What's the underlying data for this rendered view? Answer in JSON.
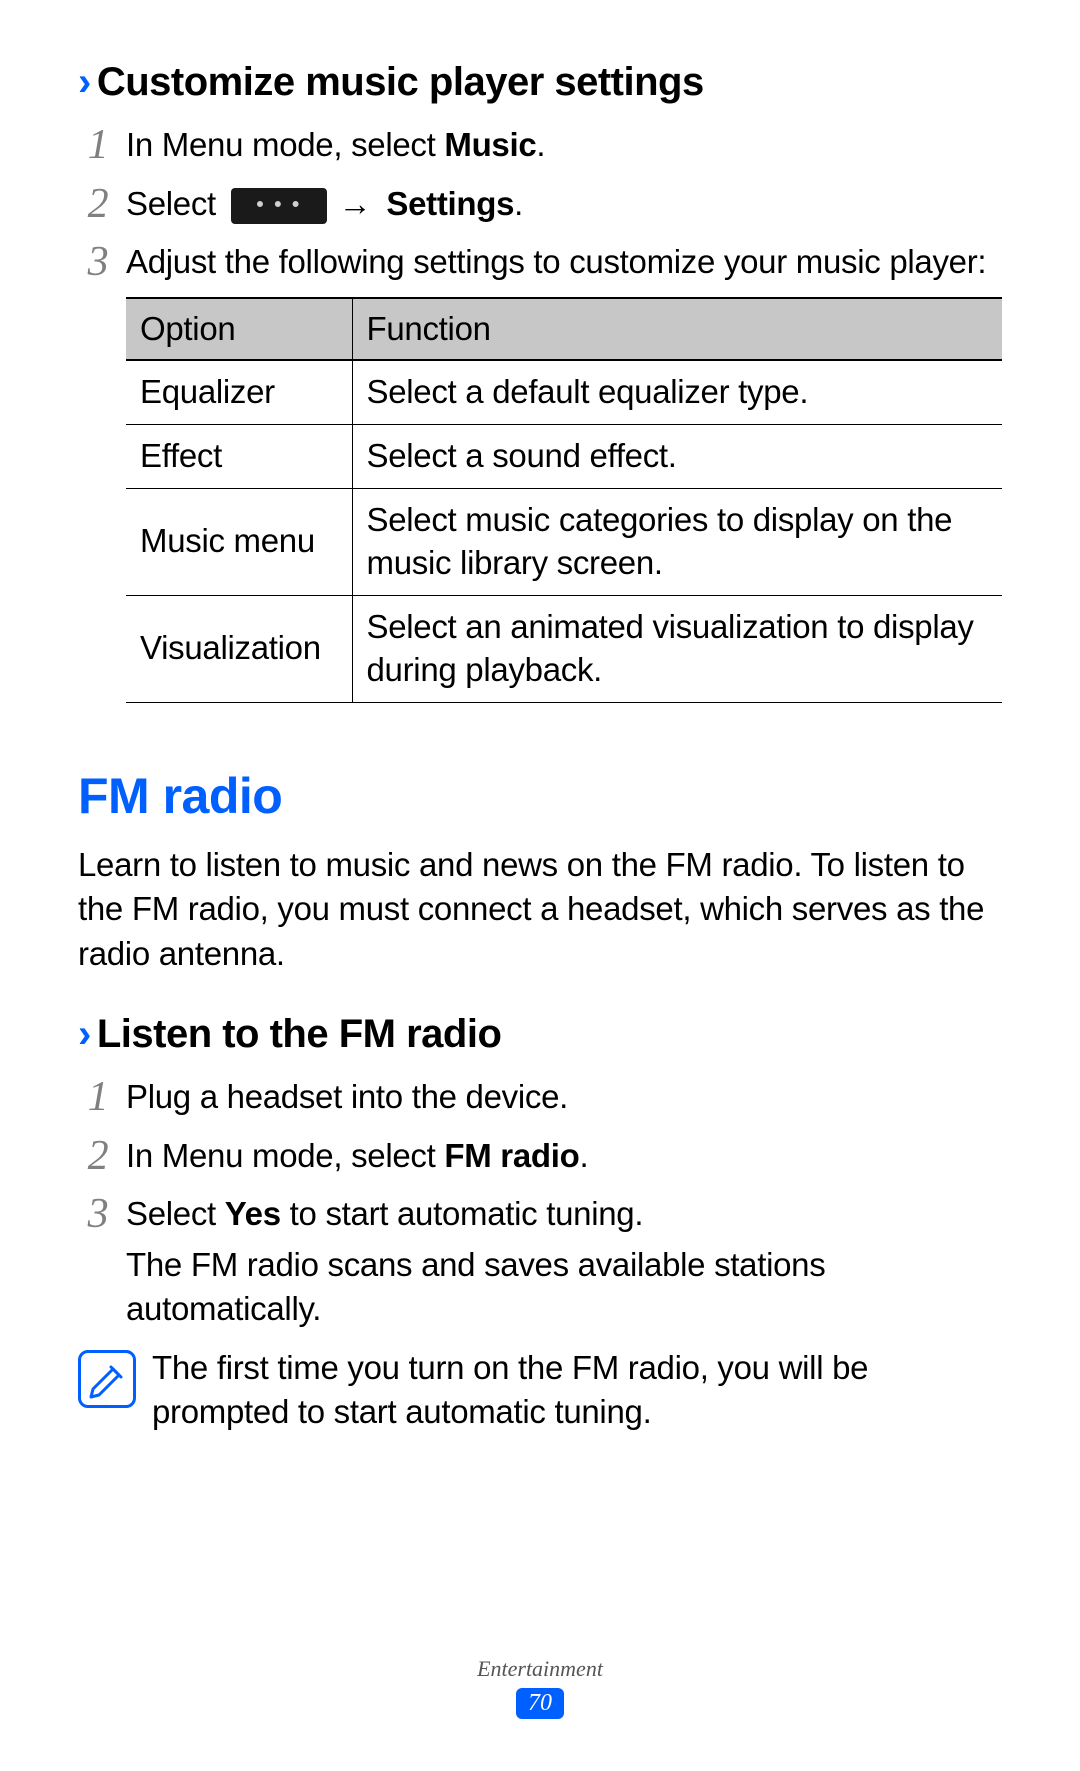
{
  "section1": {
    "heading": "Customize music player settings",
    "step1_a": "In Menu mode, select ",
    "step1_b": "Music",
    "step1_c": ".",
    "step2_a": "Select ",
    "step2_arrow": "→",
    "step2_b": "Settings",
    "step2_c": ".",
    "step3": "Adjust the following settings to customize your music player:",
    "table": {
      "h1": "Option",
      "h2": "Function",
      "rows": [
        {
          "opt": "Equalizer",
          "fn": "Select a default equalizer type."
        },
        {
          "opt": "Effect",
          "fn": "Select a sound effect."
        },
        {
          "opt": "Music menu",
          "fn": "Select music categories to display on the music library screen."
        },
        {
          "opt": "Visualization",
          "fn": "Select an animated visualization to display during playback."
        }
      ]
    }
  },
  "section2": {
    "title": "FM radio",
    "intro": "Learn to listen to music and news on the FM radio. To listen to the FM radio, you must connect a headset, which serves as the radio antenna.",
    "sub_heading": "Listen to the FM radio",
    "step1": "Plug a headset into the device.",
    "step2_a": "In Menu mode, select ",
    "step2_b": "FM radio",
    "step2_c": ".",
    "step3_a": "Select ",
    "step3_b": "Yes",
    "step3_c": " to start automatic tuning.",
    "step3_sub": "The FM radio scans and saves available stations automatically.",
    "note": "The first time you turn on the FM radio, you will be prompted to start automatic tuning."
  },
  "footer": {
    "category": "Entertainment",
    "page": "70"
  }
}
